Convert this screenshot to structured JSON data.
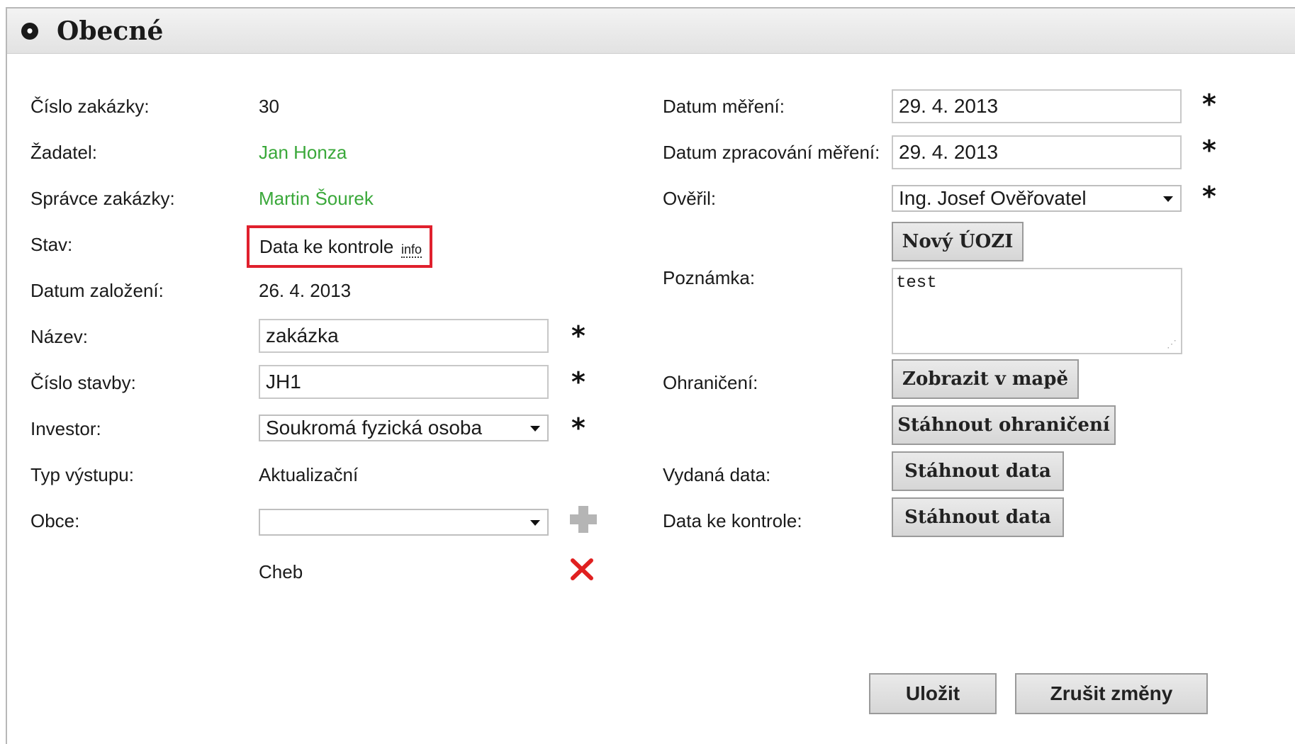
{
  "section": {
    "title": "Obecné",
    "toggle_icon": "collapse-circle-icon"
  },
  "left": {
    "order_number": {
      "label": "Číslo zakázky:",
      "value": "30"
    },
    "applicant": {
      "label": "Žadatel:",
      "value": "Jan Honza"
    },
    "order_manager": {
      "label": "Správce zakázky:",
      "value": "Martin Šourek"
    },
    "status": {
      "label": "Stav:",
      "value": "Data ke kontrole",
      "info": "info"
    },
    "created_date": {
      "label": "Datum založení:",
      "value": "26. 4. 2013"
    },
    "name": {
      "label": "Název:",
      "value": "zakázka",
      "required": "*"
    },
    "building_number": {
      "label": "Číslo stavby:",
      "value": "JH1",
      "required": "*"
    },
    "investor": {
      "label": "Investor:",
      "value": "Soukromá fyzická osoba",
      "required": "*"
    },
    "output_type": {
      "label": "Typ výstupu:",
      "value": "Aktualizační"
    },
    "municipalities": {
      "label": "Obce:",
      "value": "",
      "items": [
        "Cheb"
      ]
    }
  },
  "right": {
    "measurement_date": {
      "label": "Datum měření:",
      "value": "29. 4. 2013",
      "required": "*"
    },
    "processing_date": {
      "label": "Datum zpracování měření:",
      "value": "29. 4. 2013",
      "required": "*"
    },
    "verified_by": {
      "label": "Ověřil:",
      "value": "Ing. Josef Ověřovatel",
      "required": "*"
    },
    "new_uozi_button": "Nový ÚOZI",
    "note": {
      "label": "Poznámka:",
      "value": "test"
    },
    "boundary": {
      "label": "Ohraničení:",
      "show_map_button": "Zobrazit v mapě",
      "download_button": "Stáhnout ohraničení"
    },
    "issued_data": {
      "label": "Vydaná data:",
      "button": "Stáhnout data"
    },
    "data_to_check": {
      "label": "Data ke kontrole:",
      "button": "Stáhnout data"
    }
  },
  "actions": {
    "save": "Uložit",
    "cancel": "Zrušit změny"
  },
  "colors": {
    "link": "#3aa83a",
    "highlight_border": "#e0202d",
    "delete": "#e02020"
  }
}
